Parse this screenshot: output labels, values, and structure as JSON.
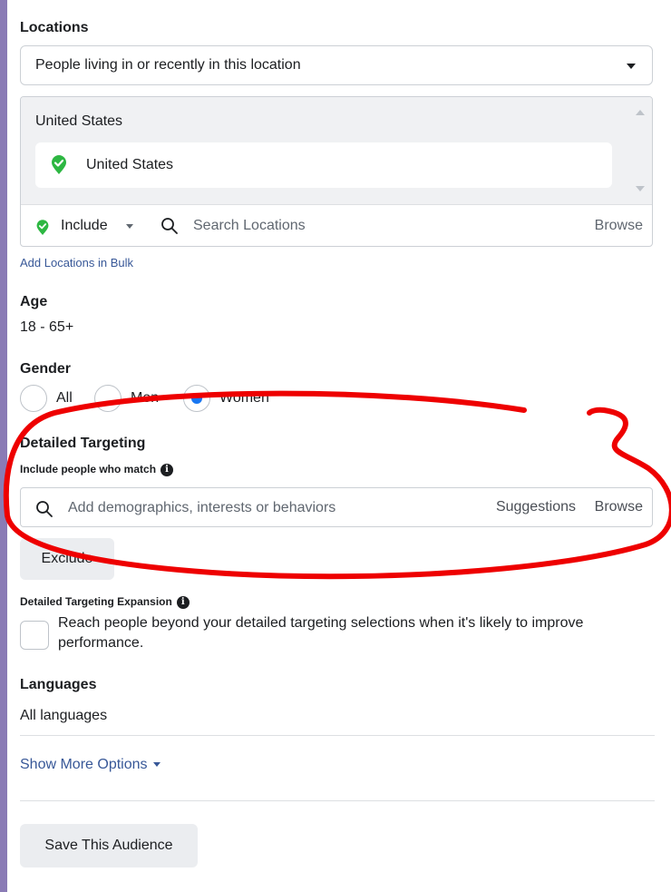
{
  "locations": {
    "title": "Locations",
    "dropdown_value": "People living in or recently in this location",
    "group_label": "United States",
    "selected": "United States",
    "include_label": "Include",
    "search_placeholder": "Search Locations",
    "browse_label": "Browse",
    "bulk_link": "Add Locations in Bulk"
  },
  "age": {
    "title": "Age",
    "value": "18 - 65+"
  },
  "gender": {
    "title": "Gender",
    "options": [
      {
        "label": "All",
        "selected": false
      },
      {
        "label": "Men",
        "selected": false
      },
      {
        "label": "Women",
        "selected": true
      }
    ]
  },
  "detailed_targeting": {
    "title": "Detailed Targeting",
    "subtitle": "Include people who match",
    "search_placeholder": "Add demographics, interests or behaviors",
    "suggestions_label": "Suggestions",
    "browse_label": "Browse",
    "exclude_label": "Exclude"
  },
  "expansion": {
    "title": "Detailed Targeting Expansion",
    "checkbox_label": "Reach people beyond your detailed targeting selections when it's likely to improve performance.",
    "checked": false
  },
  "languages": {
    "title": "Languages",
    "value": "All languages"
  },
  "more_options": {
    "label": "Show More Options"
  },
  "save_button": {
    "label": "Save This Audience"
  },
  "colors": {
    "accent": "#1877f2",
    "link": "#385898",
    "pin_green": "#2db742",
    "annotation_red": "#ee0000",
    "background_purple": "#8a7bb5"
  }
}
